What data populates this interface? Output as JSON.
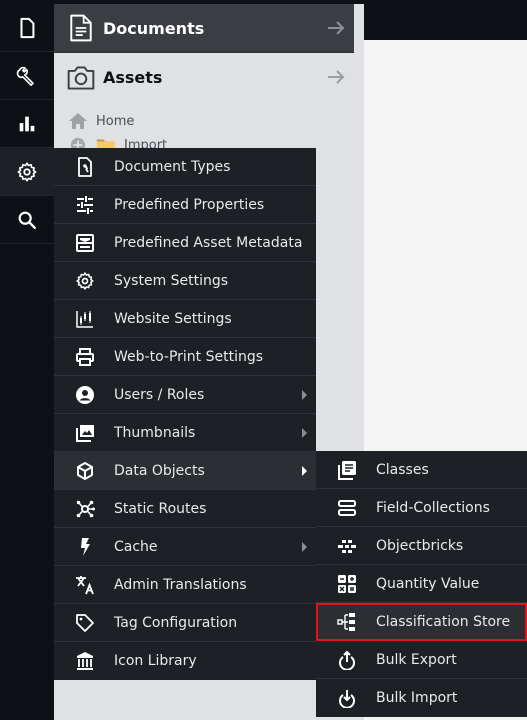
{
  "leftbar": {
    "items": [
      {
        "icon": "document-icon",
        "label": "Documents"
      },
      {
        "icon": "wrench-icon",
        "label": "Tools"
      },
      {
        "icon": "bar-chart-icon",
        "label": "Marketing"
      },
      {
        "icon": "gear-icon",
        "label": "Settings",
        "active": true
      },
      {
        "icon": "search-icon",
        "label": "Search"
      }
    ]
  },
  "tree": {
    "documents_title": "Documents",
    "assets_title": "Assets",
    "nodes": [
      {
        "label": "Home",
        "icon": "home-icon"
      },
      {
        "label": "Import",
        "icon": "folder-icon"
      }
    ]
  },
  "settings_menu": {
    "items": [
      {
        "label": "Document Types",
        "icon": "document-wrench-icon",
        "submenu": false
      },
      {
        "label": "Predefined Properties",
        "icon": "sliders-icon",
        "submenu": false
      },
      {
        "label": "Predefined Asset Metadata",
        "icon": "metadata-icon",
        "submenu": false
      },
      {
        "label": "System Settings",
        "icon": "gear-icon",
        "submenu": false
      },
      {
        "label": "Website Settings",
        "icon": "candlestick-chart-icon",
        "submenu": false
      },
      {
        "label": "Web-to-Print Settings",
        "icon": "printer-icon",
        "submenu": false
      },
      {
        "label": "Users / Roles",
        "icon": "user-circle-icon",
        "submenu": true
      },
      {
        "label": "Thumbnails",
        "icon": "images-icon",
        "submenu": true
      },
      {
        "label": "Data Objects",
        "icon": "cube-icon",
        "submenu": true,
        "hover": true
      },
      {
        "label": "Static Routes",
        "icon": "network-hub-icon",
        "submenu": false
      },
      {
        "label": "Cache",
        "icon": "lightning-icon",
        "submenu": true
      },
      {
        "label": "Admin Translations",
        "icon": "translate-icon",
        "submenu": false
      },
      {
        "label": "Tag Configuration",
        "icon": "tag-icon",
        "submenu": false
      },
      {
        "label": "Icon Library",
        "icon": "bank-icon",
        "submenu": false
      }
    ]
  },
  "data_objects_menu": {
    "items": [
      {
        "label": "Classes",
        "icon": "classes-icon"
      },
      {
        "label": "Field-Collections",
        "icon": "field-collections-icon"
      },
      {
        "label": "Objectbricks",
        "icon": "bricks-icon"
      },
      {
        "label": "Quantity Value",
        "icon": "calculator-icon"
      },
      {
        "label": "Classification Store",
        "icon": "hierarchy-icon",
        "highlighted": true
      },
      {
        "label": "Bulk Export",
        "icon": "power-up-icon"
      },
      {
        "label": "Bulk Import",
        "icon": "power-down-icon"
      }
    ]
  },
  "colors": {
    "highlight_border": "#e0141e",
    "menu_bg": "#1d2024",
    "leftbar_bg": "#0d1014"
  }
}
